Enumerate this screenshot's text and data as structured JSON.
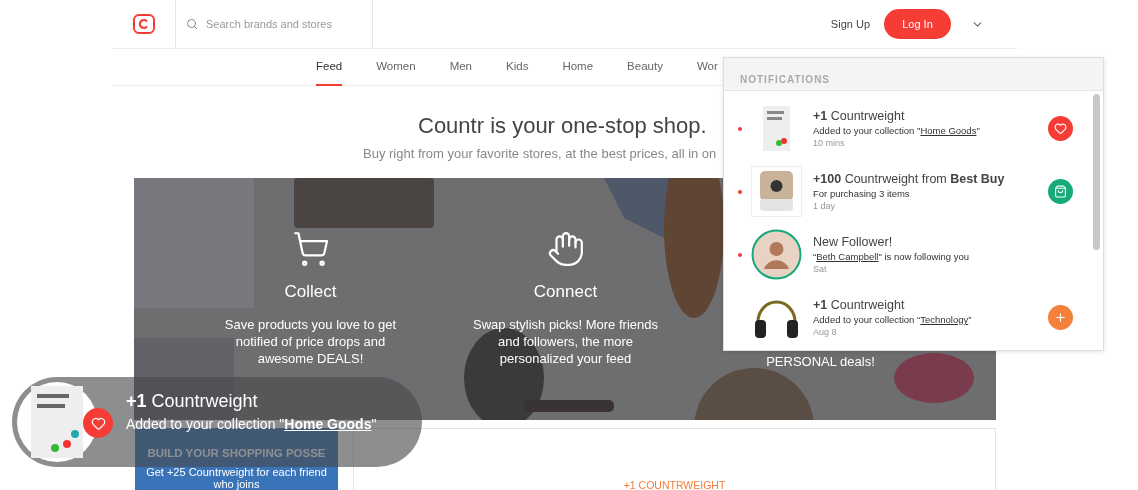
{
  "header": {
    "search": {
      "placeholder": "Search brands and stores"
    },
    "sign_up": "Sign Up",
    "log_in": "Log In"
  },
  "nav": [
    {
      "label": "Feed",
      "selected": true
    },
    {
      "label": "Women",
      "selected": false
    },
    {
      "label": "Men",
      "selected": false
    },
    {
      "label": "Kids",
      "selected": false
    },
    {
      "label": "Home",
      "selected": false
    },
    {
      "label": "Beauty",
      "selected": false
    },
    {
      "label": "Wor",
      "selected": false
    }
  ],
  "hero": {
    "title": "Countr is your one-stop shop.",
    "subtitle": "Buy right from your favorite stores, at the best prices, all in on"
  },
  "features": [
    {
      "kind": "cart",
      "title": "Collect",
      "description": "Save products you love to get notified of price drops and awesome DEALS!"
    },
    {
      "kind": "hand",
      "title": "Connect",
      "description": "Swap stylish picks! More friends and followers, the more personalized your feed"
    },
    {
      "kind": "none",
      "description": "PERSONAL deals!"
    }
  ],
  "invite_card": {
    "title": "BUILD YOUR SHOPPING POSSE",
    "text": "Get +25 Countrweight for each friend who joins"
  },
  "points_card": {
    "label": "+1 COUNTRWEIGHT"
  },
  "notifications": {
    "title": "NOTIFICATIONS",
    "items": [
      {
        "unread": true,
        "thumb": {
          "kind": "book"
        },
        "title": "**+1** Countrweight",
        "prefix": "Added to your collection \"",
        "link": "Home Goods",
        "suffix": "\"",
        "time": "10 mins",
        "action": {
          "kind": "heart"
        }
      },
      {
        "unread": true,
        "thumb": {
          "kind": "device"
        },
        "title": "**+100** Countrweight from **Best Buy**",
        "prefix": "For purchasing  3 items",
        "time": "1 day",
        "action": {
          "kind": "bag"
        }
      },
      {
        "unread": true,
        "thumb": {
          "kind": "avatar"
        },
        "title": "New Follower!",
        "prefix": "“",
        "link": "Beth Campbell",
        "suffix": "\" is now following  you",
        "time": "Sat"
      },
      {
        "unread": false,
        "thumb": {
          "kind": "headphones"
        },
        "title": "**+1** Countrweight",
        "prefix": "Added to your collection “",
        "link": "Technology",
        "suffix": "”",
        "time": "Aug 8",
        "action": {
          "kind": "plus"
        }
      }
    ]
  },
  "toast": {
    "title": "**+1** Countrweight",
    "prefix": "Added to your collection \"",
    "link": "Home Goods",
    "suffix": "\""
  }
}
